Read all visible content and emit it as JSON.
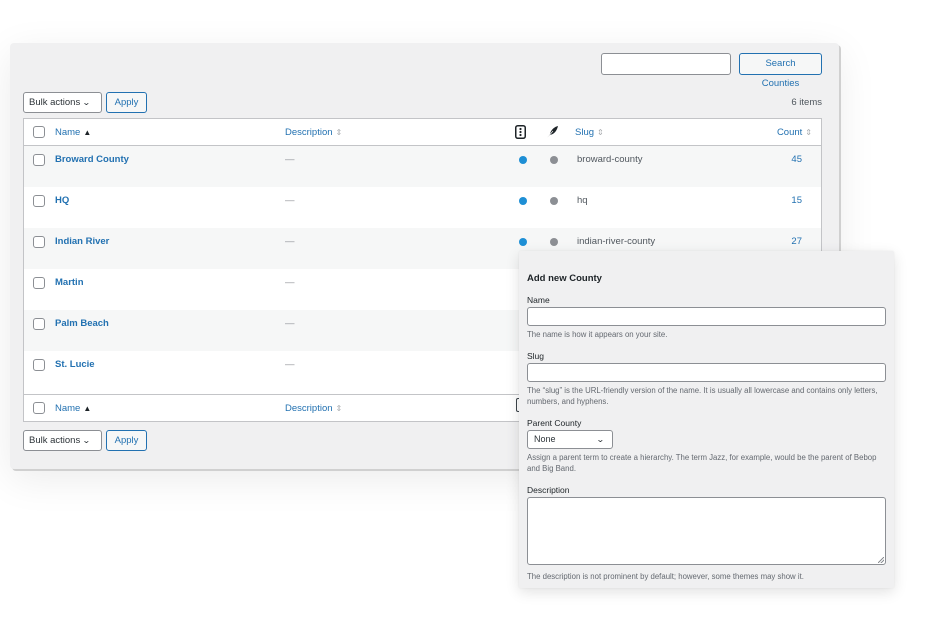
{
  "toolbar": {
    "search_placeholder": "",
    "search_value": "",
    "search_button": "Search Counties",
    "bulk_actions": "Bulk actions",
    "apply": "Apply",
    "items_count": "6 items"
  },
  "table": {
    "headers": {
      "name": "Name",
      "description": "Description",
      "col_icon_1": "phone-icon",
      "col_icon_2": "feather-icon",
      "slug": "Slug",
      "count": "Count"
    },
    "rows": [
      {
        "name": "Broward County",
        "description": "—",
        "slug": "broward-county",
        "count": "45"
      },
      {
        "name": "HQ",
        "description": "—",
        "slug": "hq",
        "count": "15"
      },
      {
        "name": "Indian River",
        "description": "—",
        "slug": "indian-river-county",
        "count": "27"
      },
      {
        "name": "Martin",
        "description": "—",
        "slug": "",
        "count": ""
      },
      {
        "name": "Palm Beach",
        "description": "—",
        "slug": "",
        "count": ""
      },
      {
        "name": "St. Lucie",
        "description": "—",
        "slug": "",
        "count": ""
      }
    ]
  },
  "colors": {
    "link": "#2271b1",
    "status_blue": "#1e8fd5",
    "status_gray": "#8c8f94"
  },
  "form": {
    "title": "Add new County",
    "name_label": "Name",
    "name_value": "",
    "name_help": "The name is how it appears on your site.",
    "slug_label": "Slug",
    "slug_value": "",
    "slug_help": "The “slug” is the URL-friendly version of the name. It is usually all lowercase and contains only letters, numbers, and hyphens.",
    "parent_label": "Parent County",
    "parent_value": "None",
    "parent_help": "Assign a parent term to create a hierarchy. The term Jazz, for example, would be the parent of Bebop and Big Band.",
    "description_label": "Description",
    "description_value": "",
    "description_help": "The description is not prominent by default; however, some themes may show it."
  }
}
